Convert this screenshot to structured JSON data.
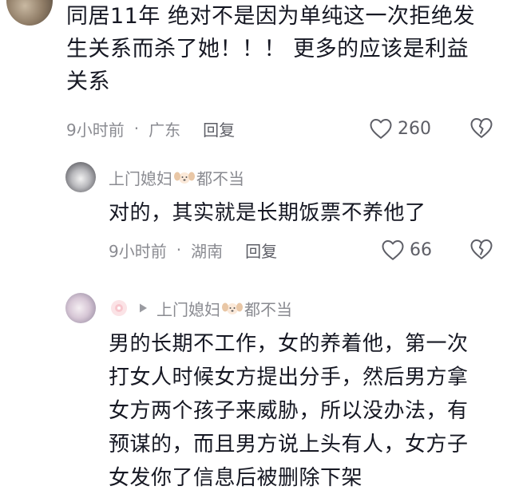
{
  "comment": {
    "text_line1": "同居11年 绝对不是因为单纯这一次拒绝发",
    "text_line2": "生关系而杀了她！！！ 更多的应该是利益",
    "text_line3": "关系",
    "time": "9小时前",
    "dot": "·",
    "location": "广东",
    "reply_label": "回复",
    "like_count": "260"
  },
  "reply1": {
    "author_prefix": "上门媳妇",
    "author_suffix": "都不当",
    "text": "对的，其实就是长期饭票不养他了",
    "time": "9小时前",
    "dot": "·",
    "location": "湖南",
    "reply_label": "回复",
    "like_count": "66"
  },
  "reply2": {
    "author_prefix": "上门媳妇",
    "author_suffix": "都不当",
    "text_line1": "男的长期不工作，女的养着他，第一次",
    "text_line2": "打女人时候女方提出分手，然后男方拿",
    "text_line3": "女方两个孩子来威胁，所以没办法，有",
    "text_line4": "预谋的，而且男方说上头有人，女方子",
    "text_line5": "女发你了信息后被删除下架"
  },
  "icons": {
    "like": "heart-outline-icon",
    "dislike": "broken-heart-icon",
    "reply_arrow": "play-arrow-icon",
    "emoji": "dog-face-emoji"
  }
}
